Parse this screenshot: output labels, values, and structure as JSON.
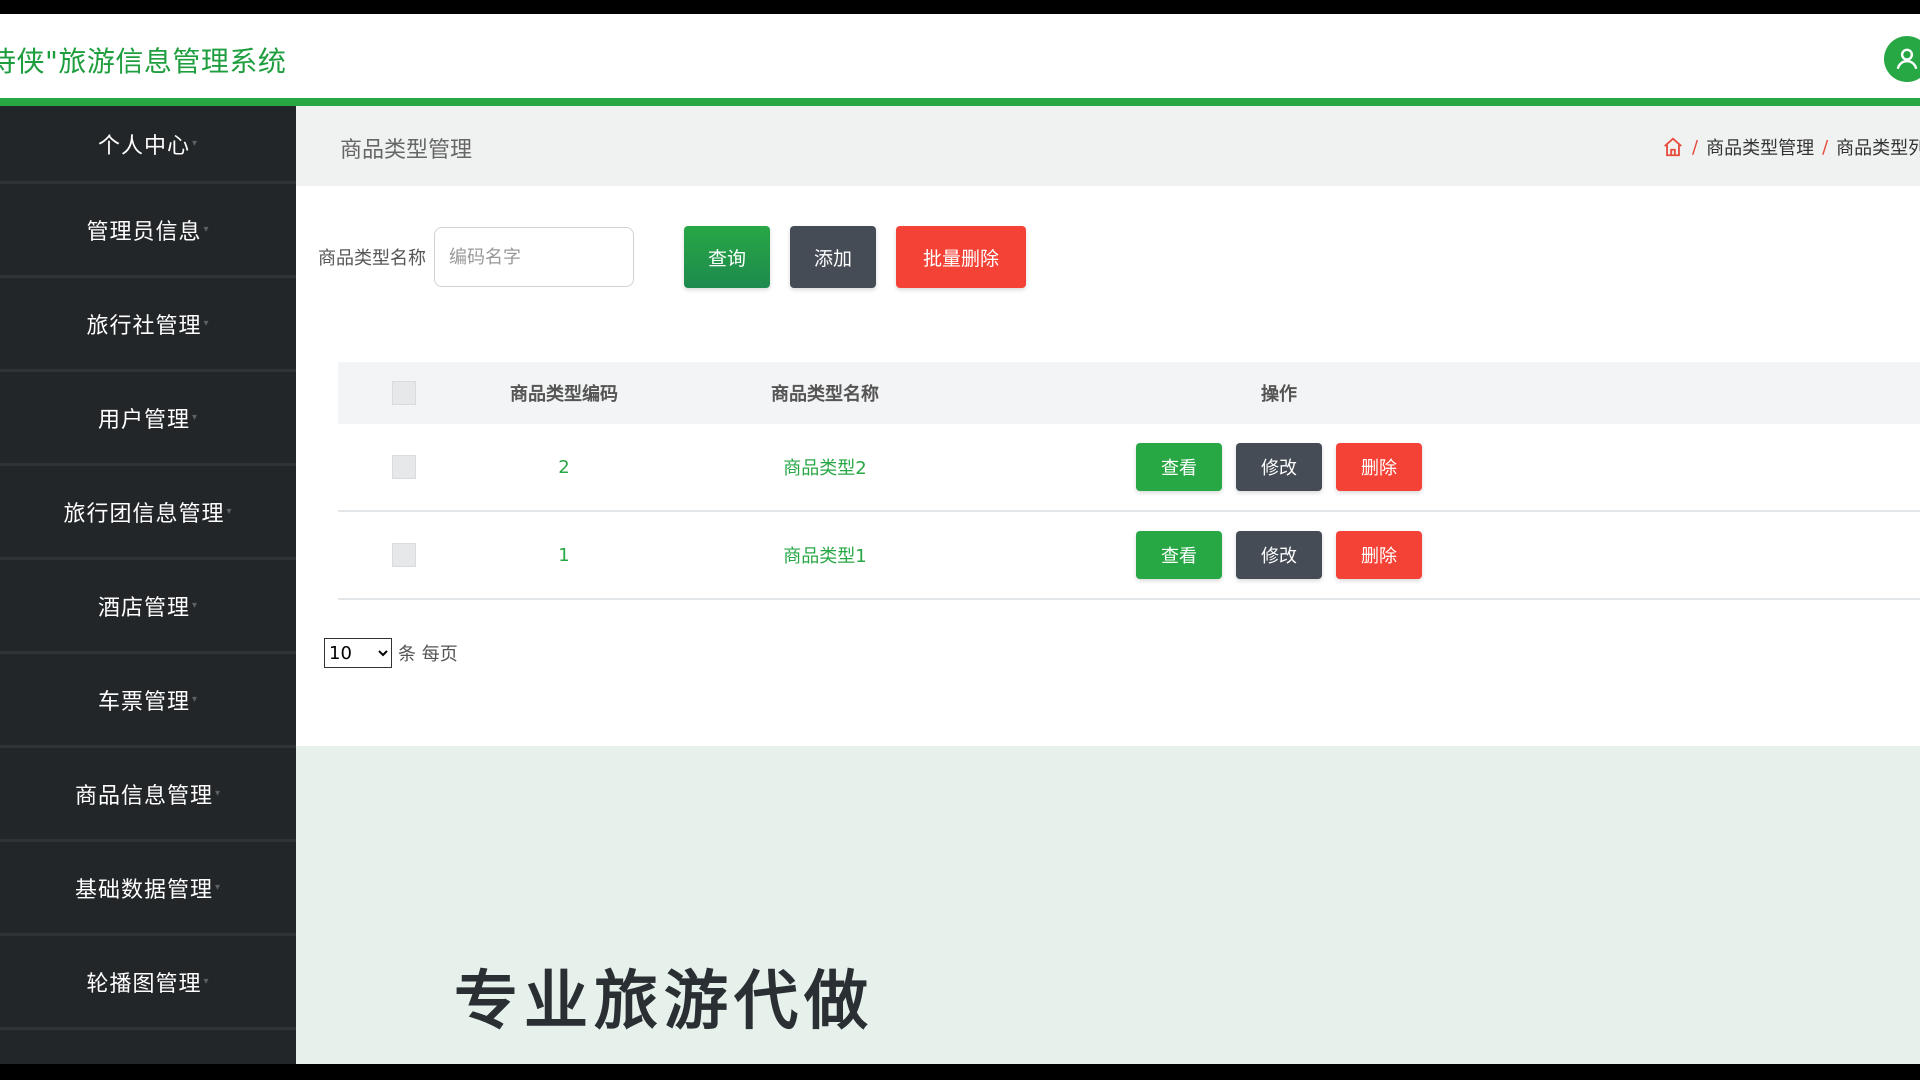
{
  "header": {
    "title": "侍侠\"旅游信息管理系统",
    "avatar_icon": "user-icon"
  },
  "sidebar": {
    "items": [
      {
        "label": "个人中心"
      },
      {
        "label": "管理员信息"
      },
      {
        "label": "旅行社管理"
      },
      {
        "label": "用户管理"
      },
      {
        "label": "旅行团信息管理"
      },
      {
        "label": "酒店管理"
      },
      {
        "label": "车票管理"
      },
      {
        "label": "商品信息管理"
      },
      {
        "label": "基础数据管理"
      },
      {
        "label": "轮播图管理"
      }
    ]
  },
  "page": {
    "title": "商品类型管理",
    "breadcrumb": [
      "商品类型管理",
      "商品类型列表"
    ]
  },
  "search": {
    "label": "商品类型名称",
    "placeholder": "编码名字",
    "value": "",
    "query_label": "查询",
    "add_label": "添加",
    "batch_delete_label": "批量删除"
  },
  "table": {
    "columns": [
      "商品类型编码",
      "商品类型名称",
      "操作"
    ],
    "rows": [
      {
        "code": "2",
        "name": "商品类型2"
      },
      {
        "code": "1",
        "name": "商品类型1"
      }
    ],
    "actions": {
      "view": "查看",
      "edit": "修改",
      "delete": "删除"
    }
  },
  "pagination": {
    "page_size": "10",
    "page_size_options": [
      "10"
    ],
    "suffix": "条 每页"
  },
  "background_text": "专业旅游代做",
  "colors": {
    "primary": "#28a745",
    "sidebar_bg": "#222628",
    "danger": "#f44336",
    "dark_button": "#454c56"
  }
}
